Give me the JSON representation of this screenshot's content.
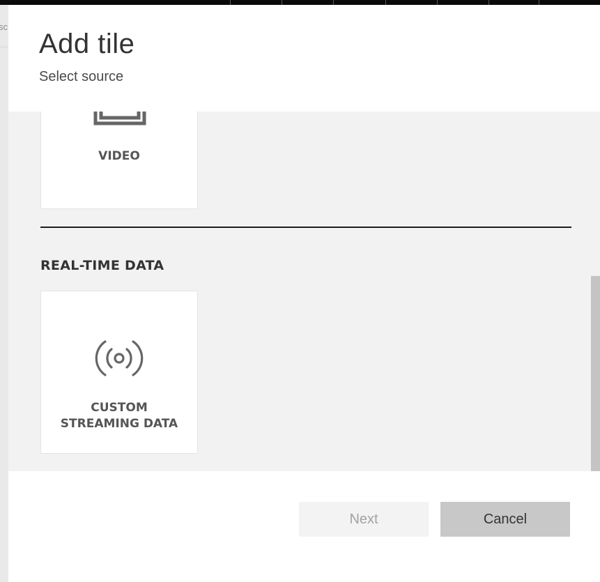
{
  "backdrop": {
    "fragment": "sc"
  },
  "dialog": {
    "title": "Add tile",
    "subtitle": "Select source"
  },
  "tiles": [
    {
      "label": "VIDEO",
      "icon": "video-icon"
    },
    {
      "label": "CUSTOM\nSTREAMING DATA",
      "icon": "streaming-data-icon"
    }
  ],
  "sections": [
    {
      "heading": "REAL-TIME DATA"
    }
  ],
  "buttons": {
    "next": {
      "label": "Next",
      "enabled": false
    },
    "cancel": {
      "label": "Cancel",
      "enabled": true
    }
  },
  "colors": {
    "content_bg": "#f2f2f2",
    "tile_bg": "#ffffff",
    "icon": "#666666",
    "cancel_bg": "#c8c8c8",
    "next_bg": "#f3f3f3"
  }
}
